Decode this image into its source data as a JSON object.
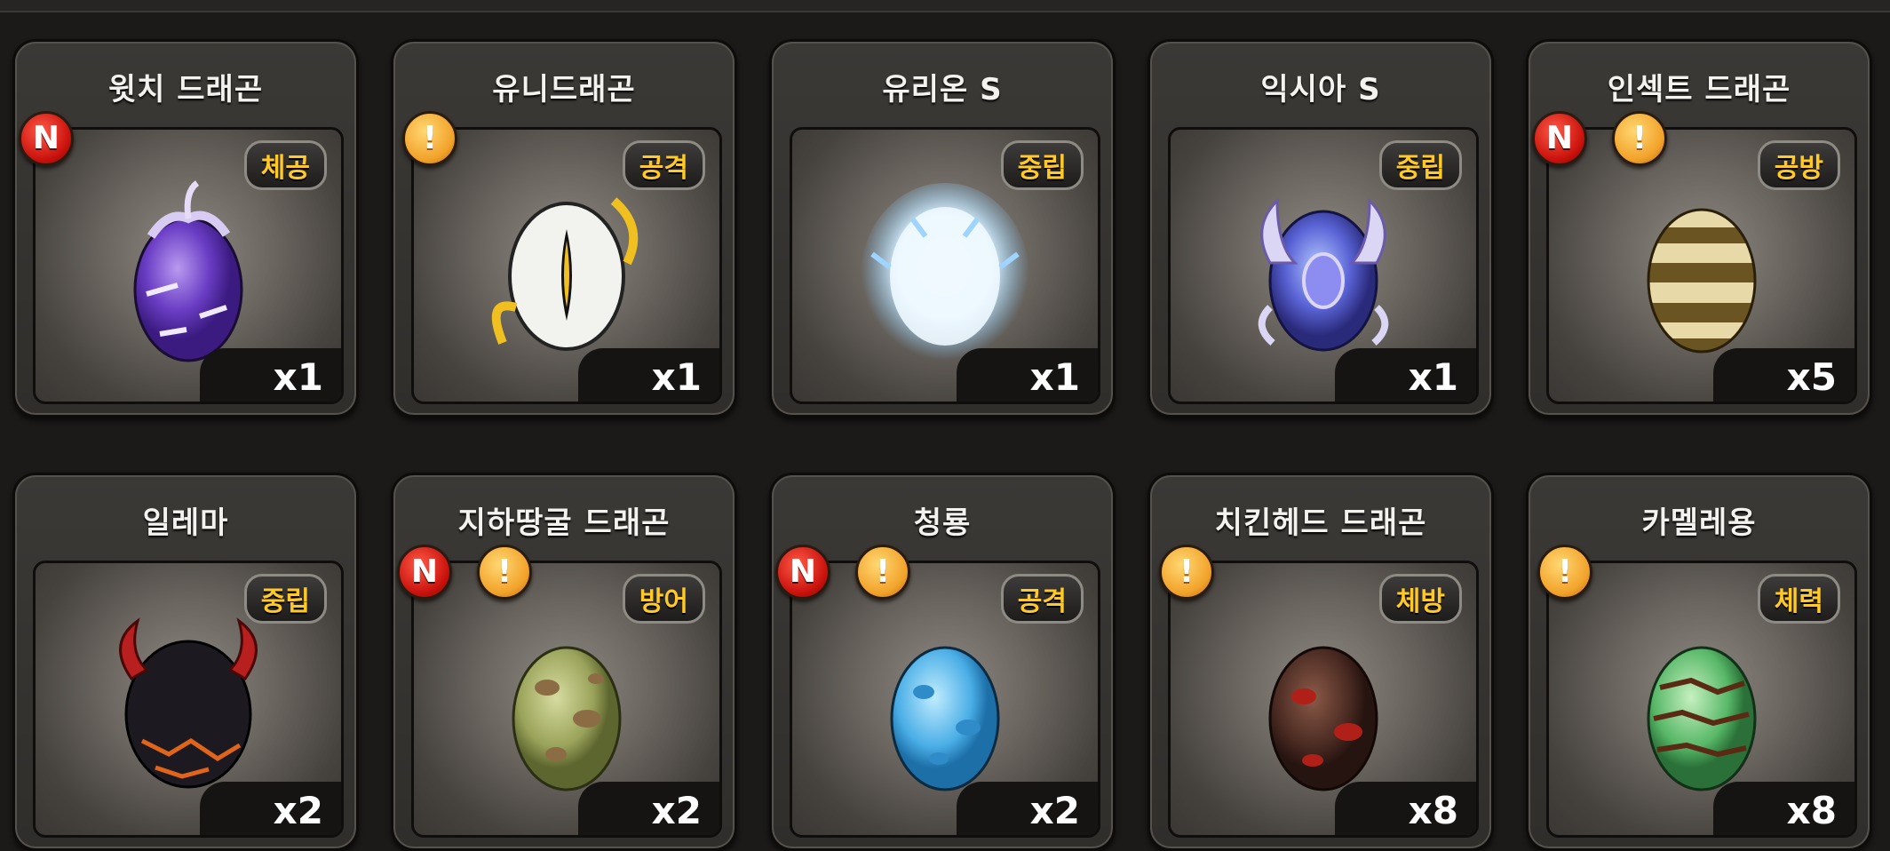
{
  "eggs": [
    {
      "name": "윗치 드래곤",
      "type": "체공",
      "count": "x1",
      "badges": [
        "N"
      ]
    },
    {
      "name": "유니드래곤",
      "type": "공격",
      "count": "x1",
      "badges": [
        "!"
      ]
    },
    {
      "name": "유리온 S",
      "type": "중립",
      "count": "x1",
      "badges": []
    },
    {
      "name": "익시아 S",
      "type": "중립",
      "count": "x1",
      "badges": []
    },
    {
      "name": "인섹트 드래곤",
      "type": "공방",
      "count": "x5",
      "badges": [
        "N",
        "!"
      ]
    },
    {
      "name": "일레마",
      "type": "중립",
      "count": "x2",
      "badges": []
    },
    {
      "name": "지하땅굴 드래곤",
      "type": "방어",
      "count": "x2",
      "badges": [
        "N",
        "!"
      ]
    },
    {
      "name": "청룡",
      "type": "공격",
      "count": "x2",
      "badges": [
        "N",
        "!"
      ]
    },
    {
      "name": "치킨헤드 드래곤",
      "type": "체방",
      "count": "x8",
      "badges": [
        "!"
      ]
    },
    {
      "name": "카멜레용",
      "type": "체력",
      "count": "x8",
      "badges": [
        "!"
      ]
    }
  ],
  "badge_labels": {
    "new": "N",
    "alert": "!"
  },
  "colors": {
    "type_tag_text": "#ffc928",
    "new_badge": "#c9120c",
    "alert_badge": "#f2a22a"
  },
  "egg_icons": [
    "purple-witch-egg-icon",
    "white-horned-egg-icon",
    "glowing-ice-egg-icon",
    "crystal-winged-egg-icon",
    "striped-insect-egg-icon",
    "horned-lava-egg-icon",
    "green-spotted-egg-icon",
    "blue-spotted-egg-icon",
    "brown-red-egg-icon",
    "green-camo-egg-icon"
  ]
}
